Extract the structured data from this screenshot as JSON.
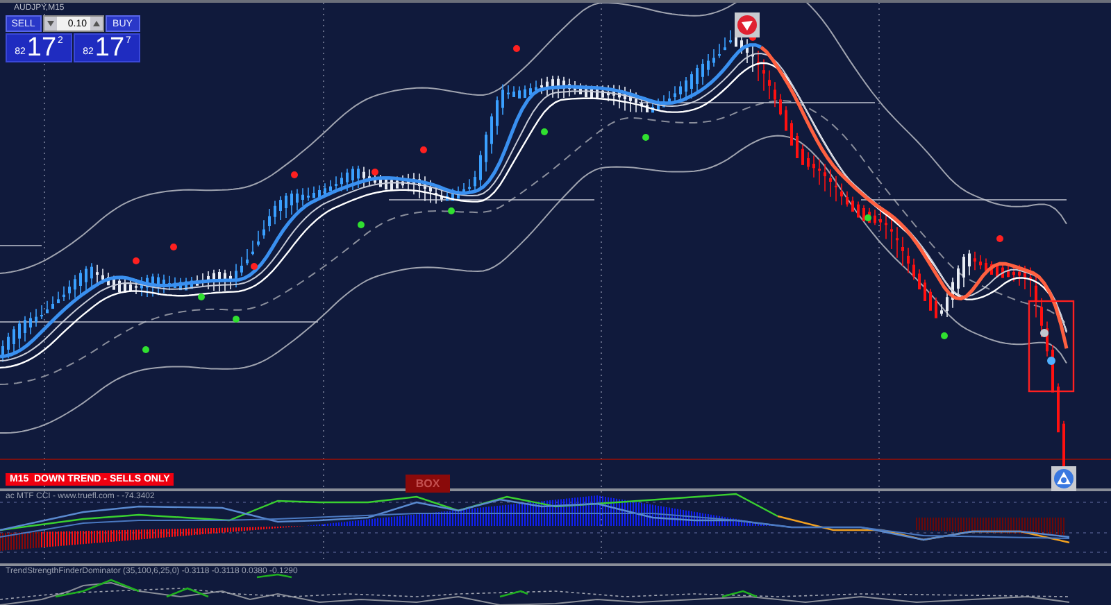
{
  "chart": {
    "symbol": "AUDJPY,M15"
  },
  "trade_panel": {
    "sell_label": "SELL",
    "buy_label": "BUY",
    "lot": "0.10",
    "bid": {
      "prefix": "82",
      "big": "17",
      "small": "2"
    },
    "ask": {
      "prefix": "82",
      "big": "17",
      "small": "7"
    }
  },
  "trend_banner": "M15  DOWN TREND - SELLS ONLY",
  "box_button": "BOX",
  "indicators": [
    {
      "kind": "cci",
      "title": "ac MTF CCI - www.truefl.com - -74.3402"
    },
    {
      "kind": "oscillator",
      "title": "TrendStrengthFinderDominator (35,100,6,25,0) -0.3118 -0.3118 0.0380 -0.1290"
    }
  ]
}
